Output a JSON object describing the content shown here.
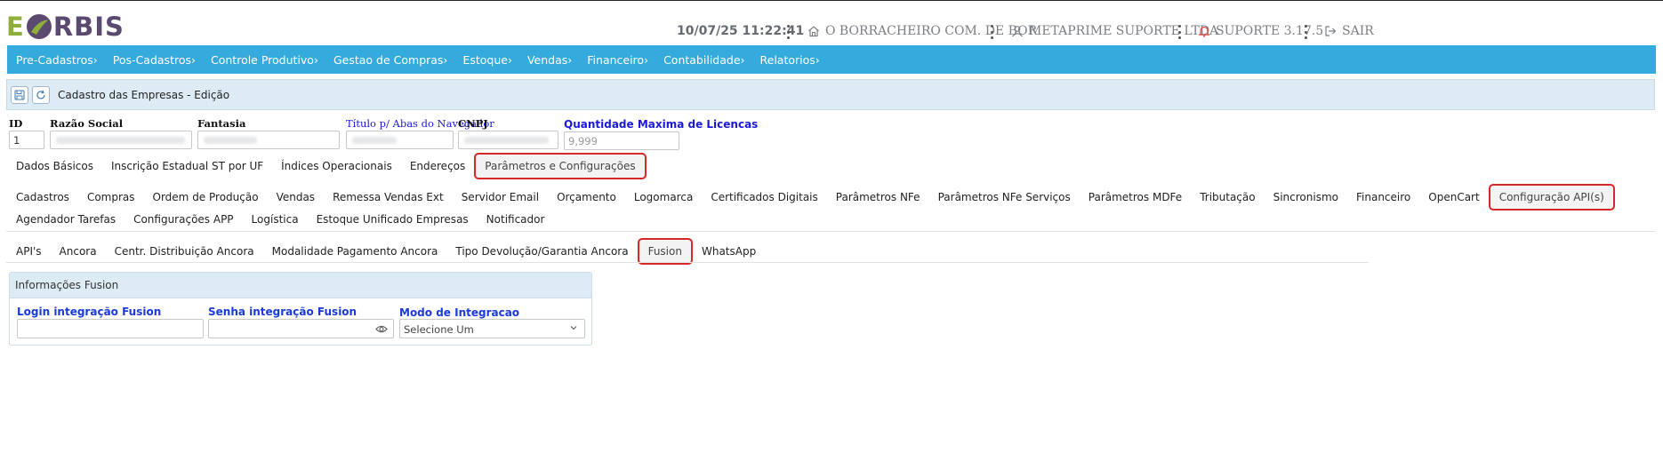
{
  "header": {
    "logo_left": "E",
    "logo_right": "RBIS",
    "datetime": "10/07/25 11:22:41",
    "branch": "O BORRACHEIRO COM. DE BOR",
    "company": "METAPRIME SUPORTE LTDA",
    "support": "SUPORTE 3.17.5",
    "logout": "SAIR",
    "colors": {
      "logo_green": "#8fae3a",
      "logo_purple": "#5b4a6f",
      "bell": "#e0443a"
    }
  },
  "nav": {
    "items": [
      {
        "label": "Pre-Cadastros›"
      },
      {
        "label": "Pos-Cadastros›"
      },
      {
        "label": "Controle Produtivo›"
      },
      {
        "label": "Gestao de Compras›"
      },
      {
        "label": "Estoque›"
      },
      {
        "label": "Vendas›"
      },
      {
        "label": "Financeiro›"
      },
      {
        "label": "Contabilidade›"
      },
      {
        "label": "Relatorios›"
      }
    ],
    "color": "#35aadd"
  },
  "page": {
    "title": "Cadastro das Empresas - Edição",
    "save_icon": "save-icon",
    "refresh_icon": "refresh-icon"
  },
  "fields": {
    "id_label": "ID",
    "id_value": "1",
    "razao_label": "Razão Social",
    "fantasia_label": "Fantasia",
    "titulo_label": "Título p/ Abas do Navegador",
    "cnpj_label": "CNPJ",
    "qtd_label": "Quantidade Maxima de Licencas",
    "qtd_placeholder": "9,999"
  },
  "main_tabs": [
    {
      "label": "Dados Básicos"
    },
    {
      "label": "Inscrição Estadual ST por UF"
    },
    {
      "label": "Índices Operacionais"
    },
    {
      "label": "Endereços"
    },
    {
      "label": "Parâmetros e Configurações",
      "active": true
    }
  ],
  "param_tabs_row1": [
    {
      "label": "Cadastros"
    },
    {
      "label": "Compras"
    },
    {
      "label": "Ordem de Produção"
    },
    {
      "label": "Vendas"
    },
    {
      "label": "Remessa Vendas Ext"
    },
    {
      "label": "Servidor Email"
    },
    {
      "label": "Orçamento"
    },
    {
      "label": "Logomarca"
    },
    {
      "label": "Certificados Digitais"
    },
    {
      "label": "Parâmetros NFe"
    },
    {
      "label": "Parâmetros NFe Serviços"
    },
    {
      "label": "Parâmetros MDFe"
    },
    {
      "label": "Tributação"
    },
    {
      "label": "Sincronismo"
    },
    {
      "label": "Financeiro"
    },
    {
      "label": "OpenCart"
    },
    {
      "label": "Configuração API(s)",
      "active": true
    }
  ],
  "param_tabs_row2": [
    {
      "label": "Agendador Tarefas"
    },
    {
      "label": "Configurações APP"
    },
    {
      "label": "Logística"
    },
    {
      "label": "Estoque Unificado Empresas"
    },
    {
      "label": "Notificador"
    }
  ],
  "api_tabs": [
    {
      "label": "API's"
    },
    {
      "label": "Ancora"
    },
    {
      "label": "Centr. Distribuição Ancora"
    },
    {
      "label": "Modalidade Pagamento Ancora"
    },
    {
      "label": "Tipo Devolução/Garantia Ancora"
    },
    {
      "label": "Fusion",
      "active": true
    },
    {
      "label": "WhatsApp"
    }
  ],
  "fusion_panel": {
    "title": "Informações Fusion",
    "login_label": "Login integração Fusion",
    "login_value": "",
    "senha_label": "Senha integração Fusion",
    "senha_value": "",
    "modo_label": "Modo de Integracao",
    "modo_value": "Selecione Um"
  }
}
